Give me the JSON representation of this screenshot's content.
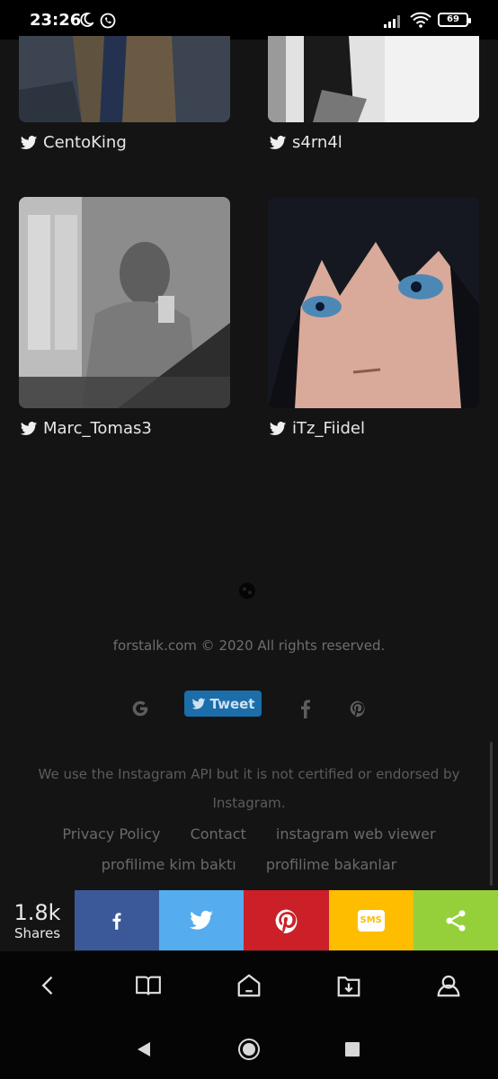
{
  "status_bar": {
    "time": "23:26",
    "battery": "69",
    "icons": [
      "moon-icon",
      "whatsapp-icon",
      "signal-icon",
      "wifi-icon",
      "battery-icon"
    ]
  },
  "profiles": [
    {
      "username": "CentoKing",
      "icon": "twitter-icon"
    },
    {
      "username": "s4rn4l",
      "icon": "twitter-icon"
    },
    {
      "username": "Marc_Tomas3",
      "icon": "twitter-icon"
    },
    {
      "username": "iTz_Fiidel",
      "icon": "twitter-icon"
    }
  ],
  "footer": {
    "copyright": "forstalk.com © 2020 All rights reserved.",
    "tweet_label": "Tweet",
    "share_icons": [
      "google-icon",
      "twitter-icon",
      "facebook-icon",
      "pinterest-icon"
    ],
    "disclaimer": "We use the Instagram API but it is not certified or endorsed by Instagram.",
    "links": [
      "Privacy Policy",
      "Contact",
      "instagram web viewer",
      "profilime kim baktı",
      "profilime bakanlar"
    ]
  },
  "share_bar": {
    "count": "1.8k",
    "count_label": "Shares",
    "buttons": [
      {
        "name": "facebook",
        "color": "#3b5998"
      },
      {
        "name": "twitter",
        "color": "#55acee"
      },
      {
        "name": "pinterest",
        "color": "#cb2027"
      },
      {
        "name": "sms",
        "color": "#ffbd00",
        "label": "SMS"
      },
      {
        "name": "share",
        "color": "#95d03a"
      }
    ]
  },
  "browser_nav": [
    "back-icon",
    "book-icon",
    "home-icon",
    "download-icon",
    "profile-icon"
  ],
  "system_nav": [
    "back-triangle-icon",
    "home-circle-icon",
    "recents-square-icon"
  ]
}
